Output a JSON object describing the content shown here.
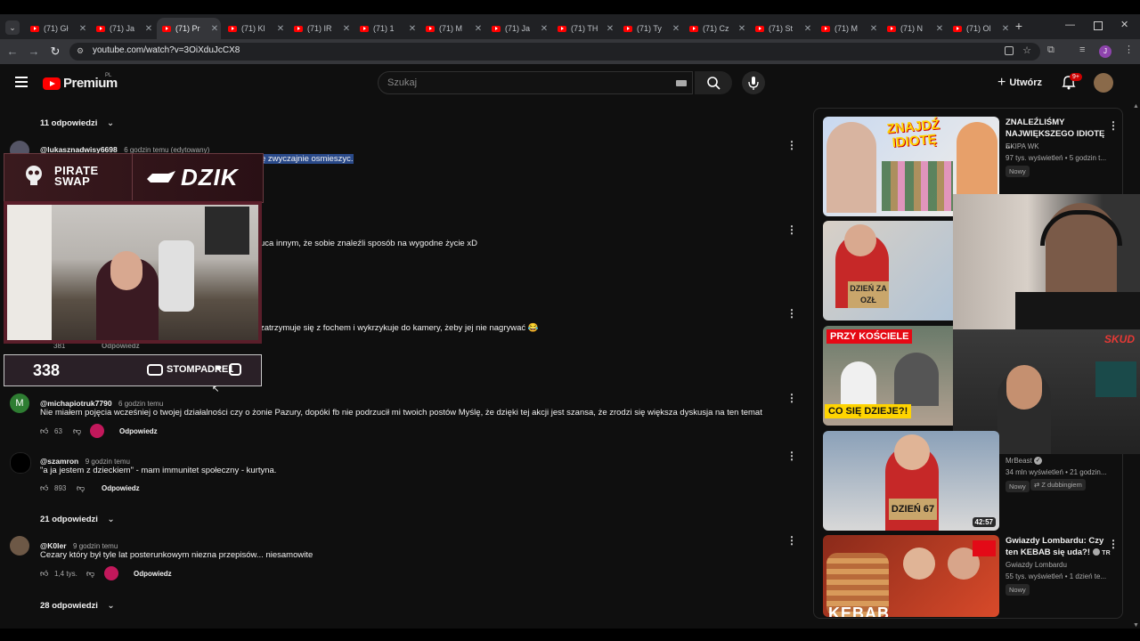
{
  "browser": {
    "tabs": [
      {
        "label": "(71) Gł"
      },
      {
        "label": "(71) Ja"
      },
      {
        "label": "(71) Pr"
      },
      {
        "label": "(71) Kl"
      },
      {
        "label": "(71) IR"
      },
      {
        "label": "(71) 1"
      },
      {
        "label": "(71) M"
      },
      {
        "label": "(71) Ja"
      },
      {
        "label": "(71) TH"
      },
      {
        "label": "(71) Ty"
      },
      {
        "label": "(71) Cz"
      },
      {
        "label": "(71) St"
      },
      {
        "label": "(71) M"
      },
      {
        "label": "(71) N"
      },
      {
        "label": "(71) Ol"
      }
    ],
    "new_tab": "+",
    "url": "youtube.com/watch?v=3OiXduJcCX8",
    "profile_initial": "J"
  },
  "youtube": {
    "logo_text": "Premium",
    "logo_region": "PL",
    "search_placeholder": "Szukaj",
    "create_label": "Utwórz",
    "notif_badge": "9+"
  },
  "comments": {
    "top_replies_toggle": "11 odpowiedzi",
    "items": [
      {
        "author": "@lukasznadwisy6698",
        "meta": "6 godzin temu (edytowany)",
        "text": "ę zwyczajnie osmieszyc."
      },
      {
        "text": "uca innym, że sobie znaleźli sposób na wygodne życie  xD"
      },
      {
        "text": "zatrzymuje się z fochem i wykrzykuje do kamery, żeby jej nie nagrywać 😂",
        "likes": "381",
        "reply_label": "Odpowiedz"
      },
      {
        "author": "@michapiotruk7790",
        "meta": "6 godzin temu",
        "avatar_letter": "M",
        "text": "Nie miałem pojęcia wcześniej o twojej działalności czy o żonie Pazury, dopóki fb nie podrzucił mi twoich postów Myślę, że dzięki tej akcji jest szansa, że zrodzi się większa dyskusja na ten temat",
        "likes": "63",
        "reply_label": "Odpowiedz"
      },
      {
        "author": "@szamron",
        "meta": "9 godzin temu",
        "text": "\"a ja jestem z dzieckiem\" - mam immunitet społeczny - kurtyna.",
        "likes": "893",
        "reply_label": "Odpowiedz",
        "replies_toggle": "21 odpowiedzi"
      },
      {
        "author": "@K0ler",
        "meta": "9 godzin temu",
        "text": "Cezary który był tyle lat posterunkowym niezna przepisów... niesamowite",
        "likes": "1,4 tys.",
        "reply_label": "Odpowiedz",
        "replies_toggle": "28 odpowiedzi"
      }
    ]
  },
  "overlay": {
    "sponsor_1": "PIRATE SWAP",
    "sponsor_2": "DZIK",
    "counter": "338",
    "social": "STOMPADRE1"
  },
  "sidebar": {
    "videos": [
      {
        "title": "ZNALEŹLIŚMY NAJWIĘKSZEGO IDIOTĘ ...",
        "channel": "EKIPA WK",
        "meta": "97 tys. wyświetleń • 5 godzin t...",
        "badge": "Nowy",
        "thumb_text": "ZNAJDŹ IDIOTĘ"
      },
      {
        "thumb_text": "DZIEŃ ZA OZŁ"
      },
      {
        "thumb_text_top": "PRZY KOŚCIELE",
        "thumb_text_bottom": "CO SIĘ DZIEJE?!"
      },
      {
        "channel": "MrBeast",
        "meta": "34 mln wyświetleń • 21 godzin...",
        "badge": "Nowy",
        "dub": "Z dubbingiem",
        "duration": "42:57",
        "thumb_text": "DZIEŃ 67"
      },
      {
        "title": "Gwiazdy Lombardu: Czy ten KEBAB się uda?!",
        "title_suffix": "TR",
        "channel": "Gwiazdy Lombardu",
        "meta": "55 tys. wyświetleń • 1 dzień te...",
        "badge": "Nowy",
        "thumb_text": "KEBAB"
      }
    ],
    "facecam_brand": "SKUD"
  }
}
